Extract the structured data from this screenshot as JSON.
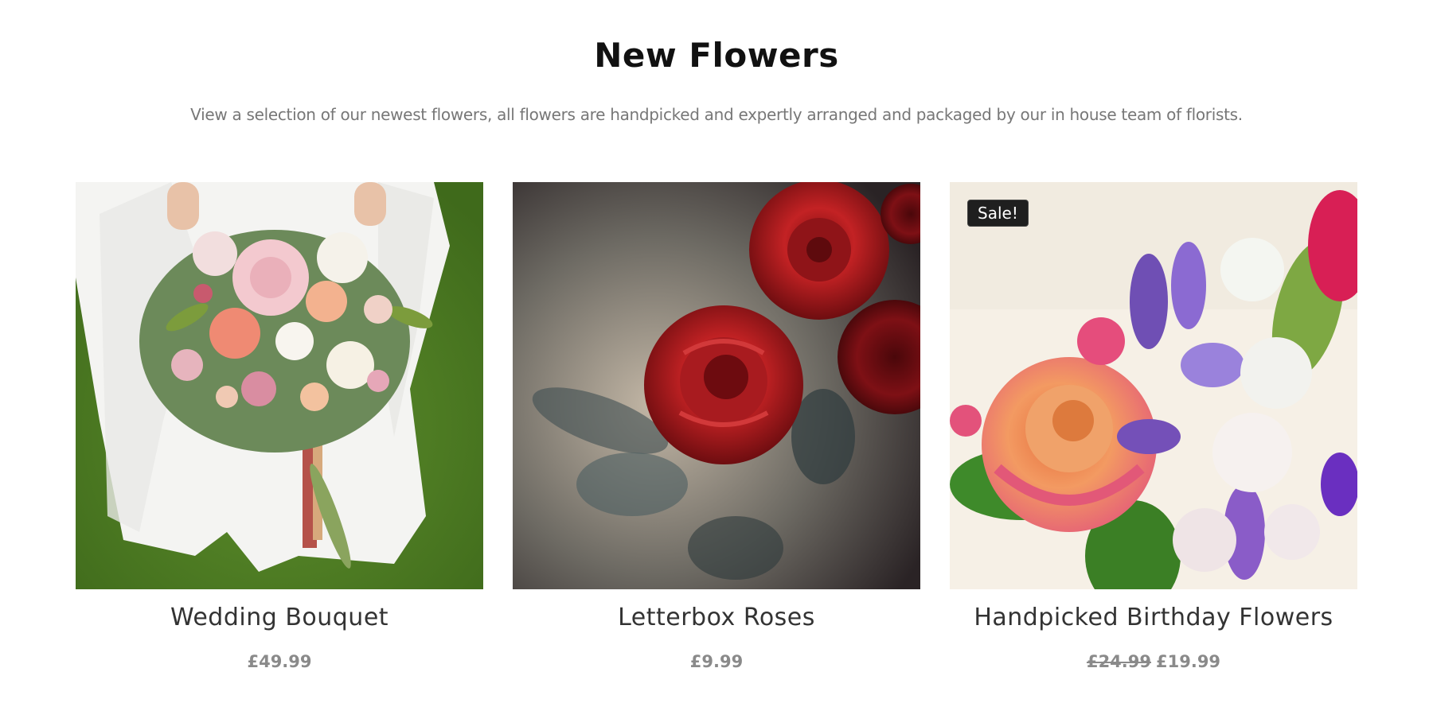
{
  "section": {
    "title": "New Flowers",
    "subtitle": "View a selection of our newest flowers, all flowers are handpicked and expertly arranged and packaged by our in house team of florists."
  },
  "products": [
    {
      "name": "Wedding Bouquet",
      "price": "£49.99",
      "image_icon": "wedding-bouquet-image"
    },
    {
      "name": "Letterbox Roses",
      "price": "£9.99",
      "image_icon": "red-roses-image"
    },
    {
      "name": "Handpicked Birthday Flowers",
      "badge": "Sale!",
      "price_old": "£24.99",
      "price": "£19.99",
      "image_icon": "birthday-flowers-image"
    }
  ],
  "colors": {
    "title": "#111111",
    "subtitle": "#777777",
    "product_name": "#333333",
    "price": "#8a8a8a",
    "badge_bg": "#1f1f1f"
  }
}
